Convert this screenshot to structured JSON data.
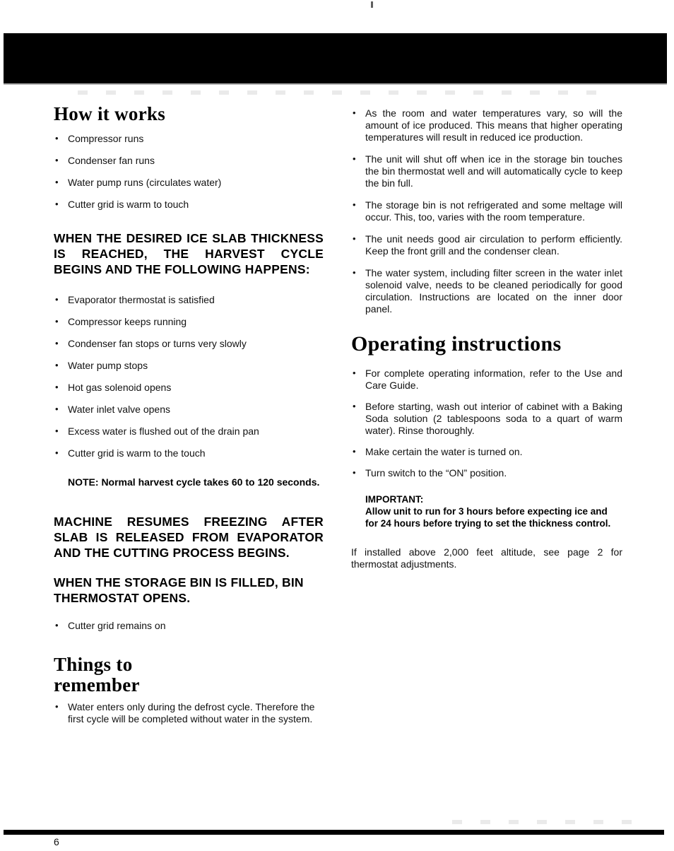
{
  "page": {
    "number": "6"
  },
  "left_column": {
    "heading_how_it_works": "How it works",
    "bullets_how_it_works": [
      "Compressor runs",
      "Condenser fan runs",
      "Water pump runs (circulates water)",
      "Cutter grid is warm to touch"
    ],
    "heading_harvest_cycle": "WHEN THE DESIRED ICE SLAB THICKNESS IS REACHED, THE HARVEST CYCLE BEGINS AND THE FOLLOWING HAPPENS:",
    "bullets_harvest_cycle": [
      "Evaporator thermostat is satisfied",
      "Compressor keeps running",
      "Condenser fan stops or turns very slowly",
      "Water pump stops",
      "Hot gas solenoid opens",
      "Water inlet valve opens",
      "Excess water is flushed out of the drain pan",
      "Cutter grid is warm to the touch"
    ],
    "note": "NOTE: Normal harvest cycle takes 60 to 120 seconds.",
    "heading_machine_resumes": "MACHINE RESUMES FREEZING AFTER SLAB IS RELEASED FROM EVAPORATOR AND THE CUTTING PROCESS BEGINS.",
    "heading_storage_bin": "WHEN THE STORAGE BIN IS FILLED, BIN THERMOSTAT OPENS.",
    "bullets_storage_bin": [
      "Cutter grid remains on"
    ],
    "heading_things_to_remember_line1": "Things to",
    "heading_things_to_remember_line2": "remember",
    "bullets_things_to_remember": [
      "Water enters only during the defrost cycle. Therefore the first cycle will be completed without water in the system."
    ]
  },
  "right_column": {
    "bullets_continued": [
      "As the room and water temperatures vary, so will the amount of ice produced. This means that higher operating temperatures will result in reduced ice production.",
      "The unit will shut off when ice in the storage bin touches the bin thermostat well and will automatically cycle to keep the bin full.",
      "The storage bin is not refrigerated and some meltage will occur. This, too, varies with the room temperature.",
      "The unit needs good air circulation to perform efficiently. Keep the front grill and the condenser clean.",
      "The water system, including filter screen in the water inlet solenoid valve, needs to be cleaned periodically for good circulation. Instructions are located on the inner door panel."
    ],
    "heading_operating_instructions": "Operating instructions",
    "bullets_operating": [
      "For complete operating information, refer to the Use and Care Guide.",
      "Before starting, wash out interior of cabinet with a Baking Soda solution (2 tablespoons soda to a quart of warm water). Rinse thoroughly.",
      "Make certain the water is turned on.",
      "Turn switch to the “ON” position."
    ],
    "important_label": "IMPORTANT:",
    "important_text": "Allow unit to run for 3 hours before expecting ice and for 24 hours before trying to set the thickness control.",
    "altitude_note": "If installed above 2,000 feet altitude, see page 2 for thermostat adjustments."
  },
  "colors": {
    "ink": "#0a0a0a",
    "paper": "#ffffff",
    "bar": "#000000"
  }
}
